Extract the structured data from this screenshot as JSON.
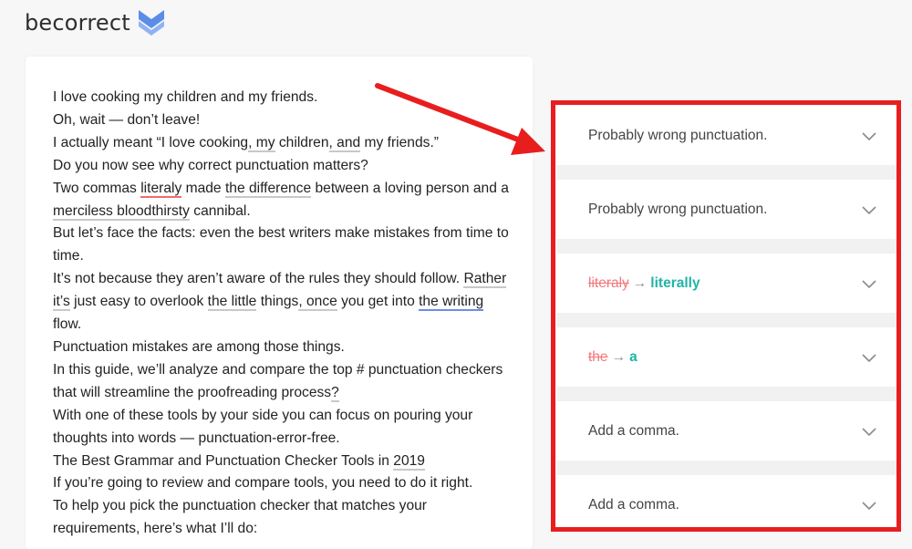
{
  "app": {
    "logo_text": "becorrect",
    "brand_color": "#5b8de8"
  },
  "editor": {
    "lines": [
      [
        "I love cooking my children and my friends."
      ],
      [
        "Oh, wait — don’t leave!"
      ],
      [
        "I actually meant “I love cooking",
        ", my",
        " children",
        ", and",
        " my friends.”"
      ],
      [
        "Do you now see why correct punctuation matters?"
      ],
      [
        "Two commas ",
        "literaly",
        " made ",
        "the difference",
        " between a loving person and a"
      ],
      [
        "merciless bloodthirsty",
        " cannibal."
      ],
      [
        "But let’s face the facts: even the best writers make mistakes from time to"
      ],
      [
        "time."
      ],
      [
        "It’s not because they aren’t aware of the rules they should follow. ",
        "Rather"
      ],
      [
        "it’s",
        " just easy to overlook ",
        "the little",
        " things",
        ", once",
        " you get into ",
        "the writing"
      ],
      [
        "flow."
      ],
      [
        "Punctuation mistakes are among those things."
      ],
      [
        "In this guide, we’ll analyze and compare the top # punctuation checkers"
      ],
      [
        "that will streamline the proofreading process",
        "?"
      ],
      [
        "With one of these tools by your side you can focus on pouring your"
      ],
      [
        "thoughts into words — punctuation-error-free."
      ],
      [
        "The Best Grammar and Punctuation Checker Tools in ",
        "2019"
      ],
      [
        "If you’re going to review and compare tools, you need to do it right."
      ],
      [
        "To help you pick the punctuation checker that matches your"
      ],
      [
        "requirements, here’s what I’ll do:"
      ]
    ]
  },
  "suggestions": [
    {
      "type": "message",
      "label": "Probably wrong punctuation.",
      "icon": "chevron-down-icon"
    },
    {
      "type": "message",
      "label": "Probably wrong punctuation.",
      "icon": "chevron-down-icon"
    },
    {
      "type": "replace",
      "original": "literaly",
      "arrow": "→",
      "replacement": "literally",
      "icon": "chevron-down-icon"
    },
    {
      "type": "replace",
      "original": "the",
      "arrow": "→",
      "replacement": "a",
      "icon": "chevron-down-icon"
    },
    {
      "type": "message",
      "label": "Add a comma.",
      "icon": "chevron-down-icon"
    },
    {
      "type": "message",
      "label": "Add a comma.",
      "icon": "chevron-down-icon"
    }
  ],
  "colors": {
    "annotation": "#e81e1e",
    "error_original": "#f2777a",
    "fix": "#1fb5a6",
    "underline_grey": "#c8c8c8",
    "underline_red": "#f26a6a",
    "underline_blue": "#6b8fe8"
  }
}
